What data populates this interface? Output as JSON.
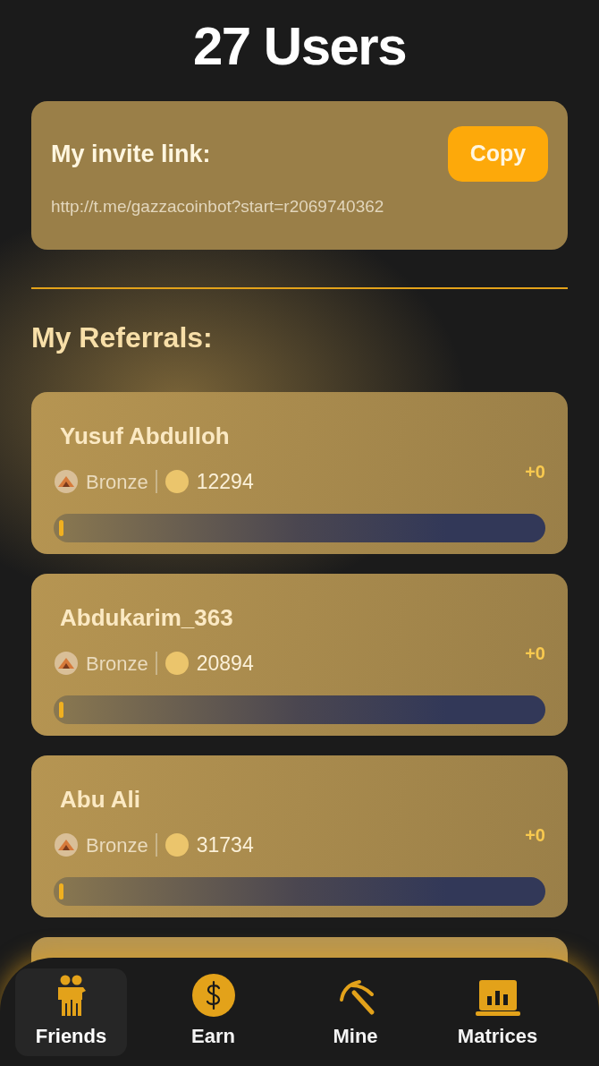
{
  "title": "27 Users",
  "invite": {
    "label": "My invite link:",
    "button": "Copy",
    "link": "http://t.me/gazzacoinbot?start=r2069740362"
  },
  "referrals_heading": "My Referrals:",
  "referrals": [
    {
      "name": "Yusuf Abdulloh",
      "league": "Bronze",
      "coins": "12294",
      "bonus": "+0",
      "level": 0.01
    },
    {
      "name": "Abdukarim_363",
      "league": "Bronze",
      "coins": "20894",
      "bonus": "+0",
      "level": 0.01
    },
    {
      "name": "Abu Ali",
      "league": "Bronze",
      "coins": "31734",
      "bonus": "+0",
      "level": 0.01
    }
  ],
  "nav": [
    {
      "label": "Friends",
      "kind": "friends",
      "selected": true
    },
    {
      "label": "Earn",
      "kind": "earn",
      "selected": false
    },
    {
      "label": "Mine",
      "kind": "mine",
      "selected": false
    },
    {
      "label": "Matrices",
      "kind": "matrices",
      "selected": false
    }
  ]
}
